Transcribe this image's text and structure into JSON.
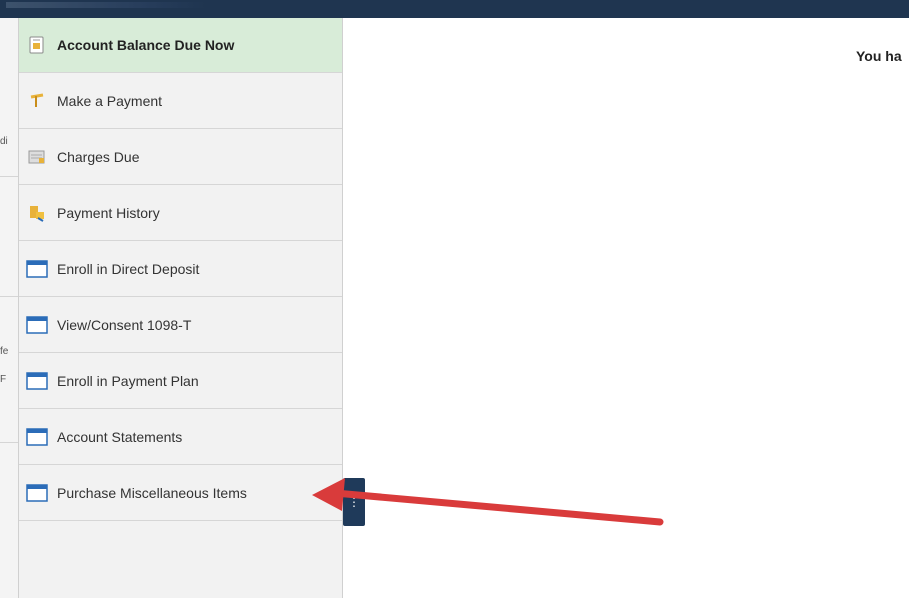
{
  "nav": {
    "items": [
      {
        "label": "Account Balance Due Now",
        "icon": "document-icon"
      },
      {
        "label": "Make a Payment",
        "icon": "payment-icon"
      },
      {
        "label": "Charges Due",
        "icon": "charges-icon"
      },
      {
        "label": "Payment History",
        "icon": "coins-icon"
      },
      {
        "label": "Enroll in Direct Deposit",
        "icon": "window-icon"
      },
      {
        "label": "View/Consent 1098-T",
        "icon": "window-icon"
      },
      {
        "label": "Enroll in Payment Plan",
        "icon": "window-icon"
      },
      {
        "label": "Account Statements",
        "icon": "window-icon"
      },
      {
        "label": "Purchase Miscellaneous Items",
        "icon": "window-icon"
      }
    ],
    "active_index": 0
  },
  "main": {
    "heading_fragment": "You ha"
  },
  "left_fragments": [
    "di",
    "fe",
    "F"
  ],
  "colors": {
    "topbar": "#1f3550",
    "active_bg": "#d8ecd8",
    "arrow": "#d93b3b"
  }
}
